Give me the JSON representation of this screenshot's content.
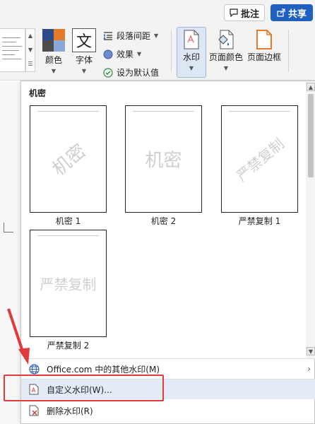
{
  "topbar": {
    "comment_label": "批注",
    "share_label": "共享",
    "comment_icon": "comment-icon",
    "share_icon": "share-icon"
  },
  "ribbon": {
    "colors_label": "颜色",
    "fonts_label": "字体",
    "fonts_glyph": "文",
    "paragraph_spacing_label": "段落间距",
    "effects_label": "效果",
    "set_default_label": "设为默认值",
    "watermark_label": "水印",
    "page_color_label": "页面颜色",
    "page_borders_label": "页面边框"
  },
  "panel": {
    "section_title": "机密",
    "thumbnails": [
      {
        "caption": "机密 1",
        "watermark": "机密",
        "orientation": "diagonal"
      },
      {
        "caption": "机密 2",
        "watermark": "机密",
        "orientation": "horizontal"
      },
      {
        "caption": "严禁复制 1",
        "watermark": "严禁复制",
        "orientation": "diagonal"
      },
      {
        "caption": "严禁复制 2",
        "watermark": "严禁复制",
        "orientation": "horizontal"
      }
    ],
    "menu": {
      "more_watermarks": "Office.com 中的其他水印(M)",
      "custom_watermark": "自定义水印(W)...",
      "remove_watermark": "删除水印(R)"
    }
  },
  "colors": {
    "accent": "#1f5fbf",
    "annotation_red": "#e23a3a",
    "highlight": "#e3ebf6"
  }
}
